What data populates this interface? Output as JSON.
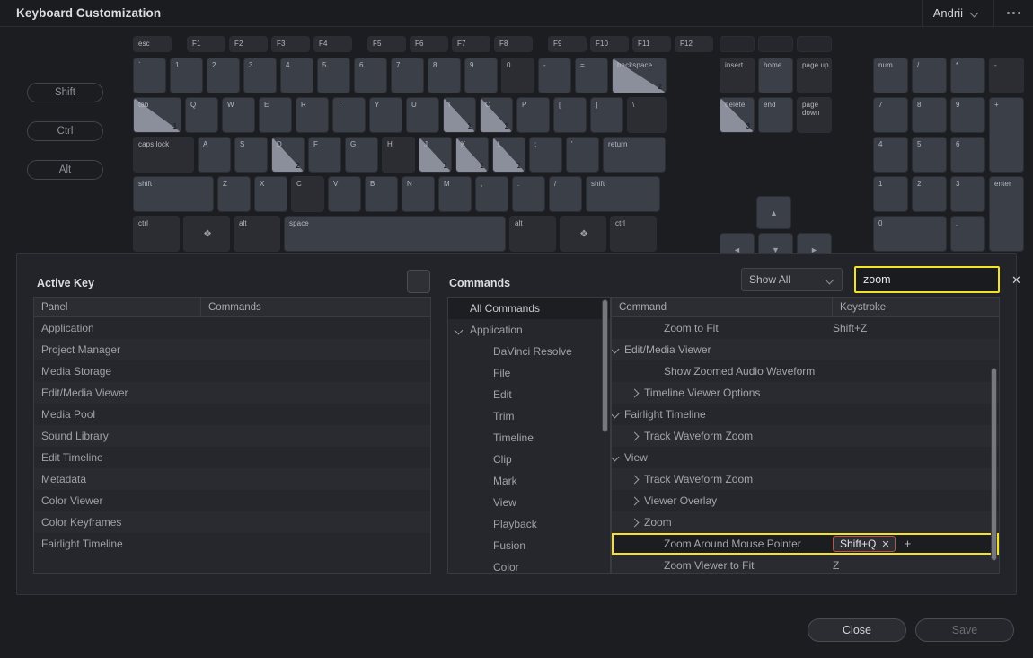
{
  "window": {
    "title": "Keyboard Customization",
    "user": "Andrii",
    "user_chevron_icon": "chevron-down-icon",
    "more_icon": "more-options-icon"
  },
  "modifiers": [
    {
      "label": "Shift"
    },
    {
      "label": "Ctrl"
    },
    {
      "label": "Alt"
    }
  ],
  "keyboard": {
    "function_row": [
      "esc",
      "F1",
      "F2",
      "F3",
      "F4",
      "F5",
      "F6",
      "F7",
      "F8",
      "F9",
      "F10",
      "F11",
      "F12"
    ],
    "number_row": [
      "`",
      "1",
      "2",
      "3",
      "4",
      "5",
      "6",
      "7",
      "8",
      "9",
      "0",
      "-",
      "=",
      "backspace"
    ],
    "backspace_count": "2",
    "tab_row": [
      "tab",
      "Q",
      "W",
      "E",
      "R",
      "T",
      "Y",
      "U",
      "I",
      "O",
      "P",
      "[",
      "]",
      "\\"
    ],
    "tab_count": "1",
    "i_count": "1",
    "o_count": "1",
    "caps_row": [
      "caps lock",
      "A",
      "S",
      "D",
      "F",
      "G",
      "H",
      "J",
      "K",
      "L",
      ";",
      "'",
      "return"
    ],
    "d_count": "2",
    "j_count": "1",
    "k_count": "1",
    "l_count": "1",
    "shift_row": [
      "shift",
      "Z",
      "X",
      "C",
      "V",
      "B",
      "N",
      "M",
      ",",
      ".",
      "/",
      "shift"
    ],
    "ctrl_row": [
      "ctrl",
      "cmd",
      "alt",
      "space",
      "alt",
      "cmd",
      "ctrl"
    ],
    "nav_blanks": [
      "",
      "",
      ""
    ],
    "nav_row1": [
      "insert",
      "home",
      "page up"
    ],
    "nav_row2": [
      "delete",
      "end",
      "page\ndown"
    ],
    "delete_count": "3",
    "arrow_up": "▲",
    "arrow_left": "◄",
    "arrow_down": "▼",
    "arrow_right": "►",
    "numpad_row1": [
      "num",
      "/",
      "*",
      "-"
    ],
    "numpad_row2": [
      "7",
      "8",
      "9"
    ],
    "numpad_plus": "+",
    "numpad_row3": [
      "4",
      "5",
      "6"
    ],
    "numpad_row4": [
      "1",
      "2",
      "3"
    ],
    "numpad_enter": "enter",
    "numpad_row5": [
      "0",
      "."
    ]
  },
  "active_key": {
    "title": "Active Key",
    "columns": [
      "Panel",
      "Commands"
    ],
    "rows": [
      {
        "panel": "Application",
        "commands": ""
      },
      {
        "panel": "Project Manager",
        "commands": ""
      },
      {
        "panel": "Media Storage",
        "commands": ""
      },
      {
        "panel": "Edit/Media Viewer",
        "commands": ""
      },
      {
        "panel": "Media Pool",
        "commands": ""
      },
      {
        "panel": "Sound Library",
        "commands": ""
      },
      {
        "panel": "Edit Timeline",
        "commands": ""
      },
      {
        "panel": "Metadata",
        "commands": ""
      },
      {
        "panel": "Color Viewer",
        "commands": ""
      },
      {
        "panel": "Color Keyframes",
        "commands": ""
      },
      {
        "panel": "Fairlight Timeline",
        "commands": ""
      }
    ]
  },
  "commands": {
    "title": "Commands",
    "filter": {
      "label": "Show All",
      "chevron_icon": "chevron-down-icon"
    },
    "search": {
      "value": "zoom",
      "placeholder": "",
      "clear_icon": "close-icon",
      "highlight_color": "#f5e128"
    },
    "tree": [
      {
        "label": "All Commands",
        "depth": 0,
        "selected": true,
        "toggle": ""
      },
      {
        "label": "Application",
        "depth": 0,
        "selected": false,
        "toggle": "down"
      },
      {
        "label": "DaVinci Resolve",
        "depth": 1,
        "selected": false,
        "toggle": ""
      },
      {
        "label": "File",
        "depth": 1,
        "selected": false,
        "toggle": ""
      },
      {
        "label": "Edit",
        "depth": 1,
        "selected": false,
        "toggle": ""
      },
      {
        "label": "Trim",
        "depth": 1,
        "selected": false,
        "toggle": ""
      },
      {
        "label": "Timeline",
        "depth": 1,
        "selected": false,
        "toggle": ""
      },
      {
        "label": "Clip",
        "depth": 1,
        "selected": false,
        "toggle": ""
      },
      {
        "label": "Mark",
        "depth": 1,
        "selected": false,
        "toggle": ""
      },
      {
        "label": "View",
        "depth": 1,
        "selected": false,
        "toggle": ""
      },
      {
        "label": "Playback",
        "depth": 1,
        "selected": false,
        "toggle": ""
      },
      {
        "label": "Fusion",
        "depth": 1,
        "selected": false,
        "toggle": ""
      },
      {
        "label": "Color",
        "depth": 1,
        "selected": false,
        "toggle": ""
      }
    ],
    "columns": [
      "Command",
      "Keystroke"
    ],
    "rows": [
      {
        "label": "Zoom to Fit",
        "keystroke": "Shift+Z",
        "depth": 2,
        "toggle": "",
        "highlight": false
      },
      {
        "label": "Edit/Media Viewer",
        "keystroke": "",
        "depth": 0,
        "toggle": "down",
        "highlight": false
      },
      {
        "label": "Show Zoomed Audio Waveform",
        "keystroke": "",
        "depth": 2,
        "toggle": "",
        "highlight": false
      },
      {
        "label": "Timeline Viewer Options",
        "keystroke": "",
        "depth": 1,
        "toggle": "right",
        "highlight": false
      },
      {
        "label": "Fairlight Timeline",
        "keystroke": "",
        "depth": 0,
        "toggle": "down",
        "highlight": false
      },
      {
        "label": "Track Waveform Zoom",
        "keystroke": "",
        "depth": 1,
        "toggle": "right",
        "highlight": false
      },
      {
        "label": "View",
        "keystroke": "",
        "depth": 0,
        "toggle": "down",
        "highlight": false
      },
      {
        "label": "Track Waveform Zoom",
        "keystroke": "",
        "depth": 1,
        "toggle": "right",
        "highlight": false
      },
      {
        "label": "Viewer Overlay",
        "keystroke": "",
        "depth": 1,
        "toggle": "right",
        "highlight": false
      },
      {
        "label": "Zoom",
        "keystroke": "",
        "depth": 1,
        "toggle": "right",
        "highlight": false
      },
      {
        "label": "Zoom Around Mouse Pointer",
        "keystroke": "Shift+Q",
        "depth": 2,
        "toggle": "",
        "highlight": true,
        "chip": true,
        "chip_clear_icon": "close-icon",
        "add_icon": "plus-icon"
      },
      {
        "label": "Zoom Viewer to Fit",
        "keystroke": "Z",
        "depth": 2,
        "toggle": "",
        "highlight": false
      }
    ]
  },
  "footer": {
    "close_label": "Close",
    "save_label": "Save"
  }
}
